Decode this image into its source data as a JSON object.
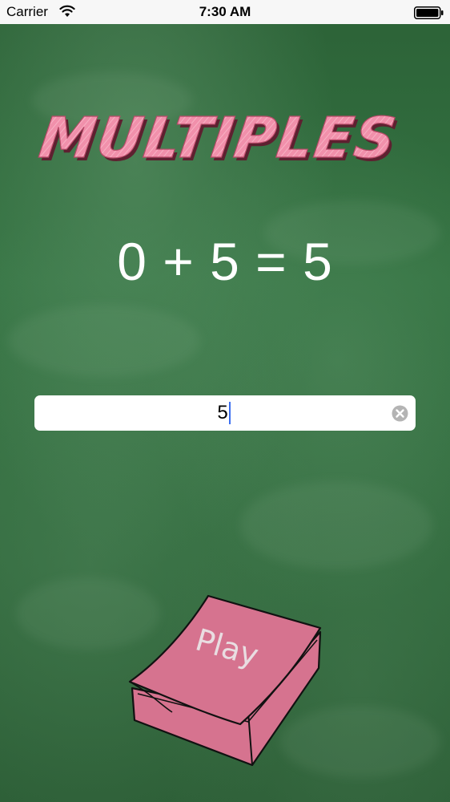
{
  "status_bar": {
    "carrier": "Carrier",
    "time": "7:30 AM"
  },
  "app": {
    "title": "MULTIPLES",
    "equation": "0 + 5 = 5",
    "answer_value": "5",
    "play_label": "Play"
  },
  "icons": {
    "wifi": "wifi-icon",
    "battery": "battery-icon",
    "clear": "clear-icon",
    "play_book": "book-icon"
  },
  "colors": {
    "chalkboard": "#2f6b3c",
    "title_pink": "#f190ab",
    "book_pink": "#d6738f",
    "caret_blue": "#3c6ff0"
  }
}
